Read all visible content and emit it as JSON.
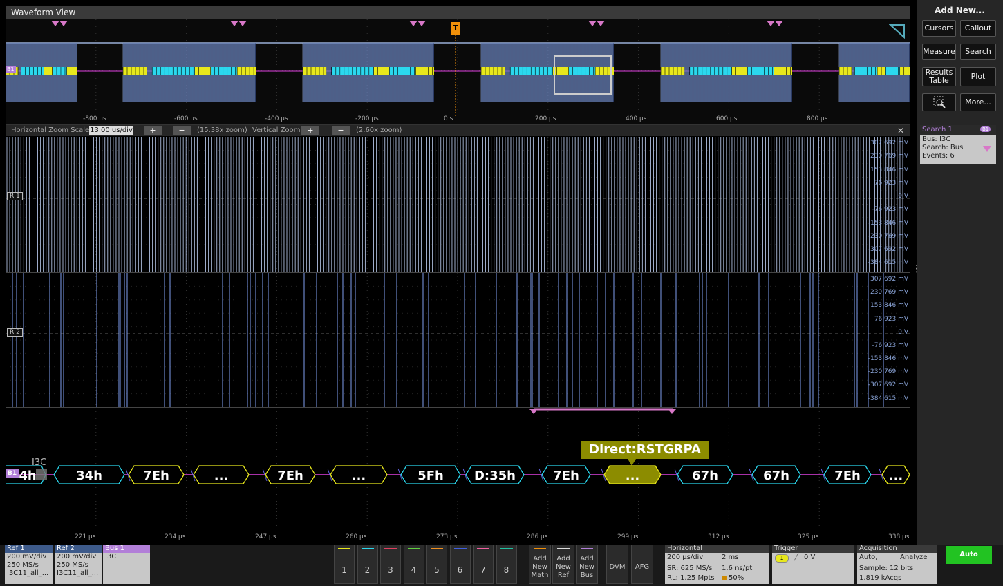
{
  "window_title": "Waveform View",
  "overview": {
    "trigger_label": "T",
    "bus_label": "B1",
    "ticks": [
      "-800 µs",
      "-600 µs",
      "-400 µs",
      "-200 µs",
      "0 s",
      "200 µs",
      "400 µs",
      "600 µs",
      "800 µs"
    ]
  },
  "zoom_bar": {
    "h_label": "Horizontal Zoom Scale",
    "h_value": "13.00 us/div",
    "h_zoom": "(15.38x zoom)",
    "v_label": "Vertical Zoom",
    "v_zoom": "(2.60x zoom)",
    "plus": "+",
    "minus": "−",
    "close": "✕"
  },
  "r1": {
    "label": "R 1",
    "scale": [
      "307.692 mV",
      "230.769 mV",
      "153.846 mV",
      "76.923 mV",
      "0 V",
      "-76.923 mV",
      "-153.846 mV",
      "-230.769 mV",
      "-307.692 mV",
      "-384.615 mV"
    ]
  },
  "r2": {
    "label": "R 2",
    "scale": [
      "307.692 mV",
      "230.769 mV",
      "153.846 mV",
      "76.923 mV",
      "0 V",
      "-76.923 mV",
      "-153.846 mV",
      "-230.769 mV",
      "-307.692 mV",
      "-384.615 mV"
    ]
  },
  "bus": {
    "label": "B1",
    "name": "I3C",
    "first_frag": "4h",
    "packets": [
      "34h",
      "7Eh",
      "...",
      "7Eh",
      "...",
      "5Fh",
      "D:35h",
      "7Eh",
      "...",
      "67h",
      "67h",
      "7Eh",
      "..."
    ],
    "callout": "Direct:RSTGRPA",
    "time_ticks": [
      "221 µs",
      "234 µs",
      "247 µs",
      "260 µs",
      "273 µs",
      "286 µs",
      "299 µs",
      "312 µs",
      "325 µs",
      "338 µs"
    ]
  },
  "sidebar": {
    "title": "Add New...",
    "cursors": "Cursors",
    "callout": "Callout",
    "measure": "Measure",
    "search": "Search",
    "results1": "Results",
    "results2": "Table",
    "plot": "Plot",
    "more": "More..."
  },
  "search_card": {
    "title": "Search 1",
    "badge": "B1",
    "bus": "Bus: I3C",
    "search": "Search: Bus",
    "events": "Events: 6"
  },
  "bottom": {
    "ref1": {
      "title": "Ref 1",
      "l1": "200 mV/div",
      "l2": "250 MS/s",
      "l3": "I3C11_all_..."
    },
    "ref2": {
      "title": "Ref 2",
      "l1": "200 mV/div",
      "l2": "250 MS/s",
      "l3": "I3C11_all_..."
    },
    "bus1": {
      "title": "Bus 1",
      "l1": "I3C"
    },
    "channels": [
      "1",
      "2",
      "3",
      "4",
      "5",
      "6",
      "7",
      "8"
    ],
    "add_math": [
      "Add",
      "New",
      "Math"
    ],
    "add_ref": [
      "Add",
      "New",
      "Ref"
    ],
    "add_bus": [
      "Add",
      "New",
      "Bus"
    ],
    "dvm": "DVM",
    "afg": "AFG",
    "horizontal": {
      "title": "Horizontal",
      "scale": "200 µs/div",
      "record": "2 ms",
      "sr": "SR: 625 MS/s",
      "pt": "1.6 ns/pt",
      "rl": "RL: 1.25 Mpts",
      "pos": "50%"
    },
    "trigger": {
      "title": "Trigger",
      "src": "1",
      "level": "0 V"
    },
    "acquisition": {
      "title": "Acquisition",
      "mode": "Auto,",
      "analyze": "Analyze",
      "sample": "Sample: 12 bits",
      "acqs": "1.819 kAcqs"
    },
    "auto": "Auto"
  },
  "colors": {
    "bus_cyan": "#2bd8ee",
    "bus_yellow": "#e8e81c",
    "bus_magenta": "#e040e0",
    "ref_blue": "#8aa4d8",
    "marker_pink": "#d878c8",
    "trigger_orange": "#f0900a",
    "callout_olive": "#8c8c00",
    "auto_green": "#22c322"
  }
}
